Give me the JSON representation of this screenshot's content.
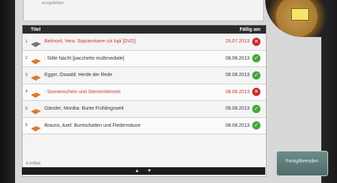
{
  "top_text": "ausgeliehen.",
  "table": {
    "headers": {
      "title": "Titel",
      "due": "Fällig am"
    },
    "rows": [
      {
        "num": "1",
        "title": "Belmont, Vera: Sopravvivere coi lupi [DVD]",
        "due": "29.07.2013",
        "status": "overdue",
        "status_icon": "x-icon"
      },
      {
        "num": "2",
        "title": ": Stille Nacht [pacchetto multimediale]",
        "due": "08.08.2013",
        "status": "ok",
        "status_icon": "check-icon"
      },
      {
        "num": "3",
        "title": "Egger, Oswald: Herde der Rede",
        "due": "08.08.2013",
        "status": "ok",
        "status_icon": "check-icon"
      },
      {
        "num": "4",
        "title": ": Sonnenschein und Sternenhimmel",
        "due": "08.08.2013",
        "status": "overdue",
        "status_icon": "x-icon"
      },
      {
        "num": "5",
        "title": "Gänsler, Monika: Bunte Frühlingswelt",
        "due": "08.08.2013",
        "status": "ok",
        "status_icon": "check-icon"
      },
      {
        "num": "6",
        "title": "Brauns, Axel: Buntschatten und Fledermäuse",
        "due": "08.08.2013",
        "status": "ok",
        "status_icon": "check-icon"
      }
    ],
    "count_text": "6 Artikel"
  },
  "button": {
    "label": "Fertig/Beenden"
  },
  "colors": {
    "overdue": "#c82d2d",
    "ok": "#43a83a"
  }
}
